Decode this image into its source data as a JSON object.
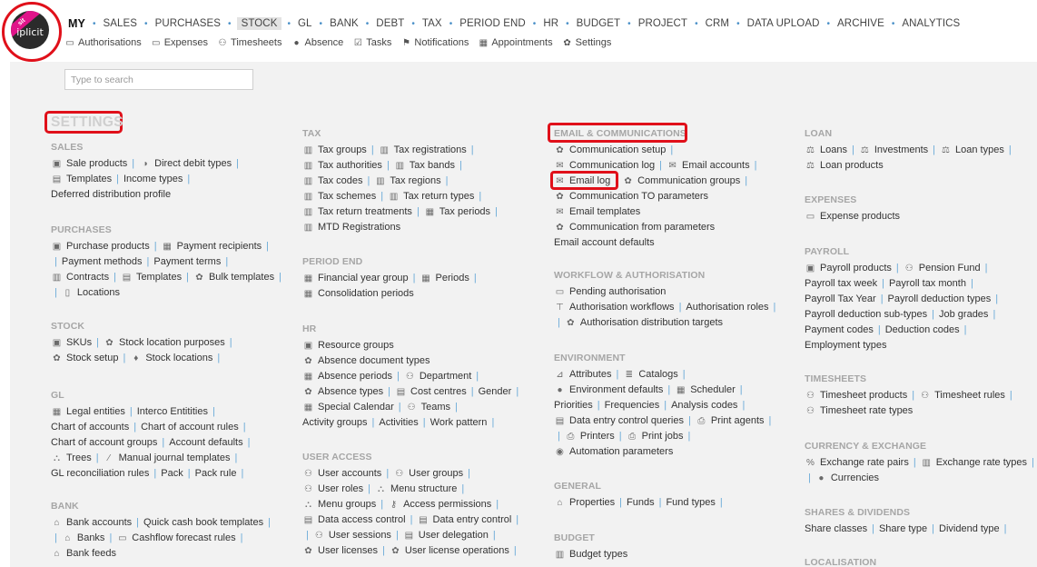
{
  "logo": {
    "ribbon": "sit",
    "text": "iplicit"
  },
  "nav": {
    "main": [
      {
        "label": "MY",
        "kind": "my"
      },
      {
        "label": "SALES"
      },
      {
        "label": "PURCHASES"
      },
      {
        "label": "STOCK",
        "kind": "current"
      },
      {
        "label": "GL"
      },
      {
        "label": "BANK"
      },
      {
        "label": "DEBT"
      },
      {
        "label": "TAX"
      },
      {
        "label": "PERIOD END"
      },
      {
        "label": "HR"
      },
      {
        "label": "BUDGET"
      },
      {
        "label": "PROJECT"
      },
      {
        "label": "CRM"
      },
      {
        "label": "DATA UPLOAD"
      },
      {
        "label": "ARCHIVE"
      },
      {
        "label": "ANALYTICS"
      }
    ],
    "sub": [
      {
        "label": "Authorisations",
        "icon": "chat-icon",
        "glyph": "▭"
      },
      {
        "label": "Expenses",
        "icon": "card-icon",
        "glyph": "▭"
      },
      {
        "label": "Timesheets",
        "icon": "people-icon",
        "glyph": "⚇"
      },
      {
        "label": "Absence",
        "icon": "person-icon",
        "glyph": "●"
      },
      {
        "label": "Tasks",
        "icon": "checkbox-icon",
        "glyph": "☑"
      },
      {
        "label": "Notifications",
        "icon": "flag-icon",
        "glyph": "⚑"
      },
      {
        "label": "Appointments",
        "icon": "calendar-icon",
        "glyph": "▦"
      },
      {
        "label": "Settings",
        "icon": "gear-icon",
        "glyph": "✿"
      }
    ]
  },
  "search": {
    "placeholder": "Type to search"
  },
  "page": {
    "title": "SETTINGS"
  },
  "sections": [
    {
      "key": "sales",
      "title": "SALES",
      "lines": [
        [
          {
            "label": "Sale products",
            "icon": "box-icon",
            "glyph": "▣"
          },
          {
            "label": "Direct debit types",
            "icon": "direct-debit-icon",
            "glyph": "◑"
          }
        ],
        [
          {
            "label": "Templates",
            "icon": "template-icon",
            "glyph": "▤"
          },
          {
            "label": "Income types"
          }
        ],
        [
          {
            "label": "Deferred distribution profile"
          }
        ]
      ]
    },
    {
      "key": "purchases",
      "title": "PURCHASES",
      "lines": [
        [
          {
            "label": "Purchase products",
            "icon": "box-icon",
            "glyph": "▣"
          },
          {
            "label": "Payment recipients",
            "icon": "ledger-icon",
            "glyph": "▦"
          }
        ],
        [
          {
            "label": "Payment methods",
            "lead": true
          },
          {
            "label": "Payment terms"
          }
        ],
        [
          {
            "label": "Contracts",
            "icon": "contract-icon",
            "glyph": "▥"
          },
          {
            "label": "Templates",
            "icon": "template-icon",
            "glyph": "▤"
          },
          {
            "label": "Bulk templates",
            "icon": "gear-icon",
            "glyph": "✿"
          }
        ],
        [
          {
            "label": "Locations",
            "icon": "building-icon",
            "glyph": "▯",
            "lead": true
          }
        ]
      ]
    },
    {
      "key": "stock",
      "title": "STOCK",
      "lines": [
        [
          {
            "label": "SKUs",
            "icon": "box-icon",
            "glyph": "▣"
          },
          {
            "label": "Stock location purposes",
            "icon": "gear-icon",
            "glyph": "✿"
          }
        ],
        [
          {
            "label": "Stock setup",
            "icon": "gear-icon",
            "glyph": "✿"
          },
          {
            "label": "Stock locations",
            "icon": "location-icon",
            "glyph": "♦"
          }
        ]
      ]
    },
    {
      "key": "gl",
      "title": "GL",
      "lines": [
        [
          {
            "label": "Legal entities",
            "icon": "ledger-icon",
            "glyph": "▦"
          },
          {
            "label": "Interco Entitities"
          }
        ],
        [
          {
            "label": "Chart of accounts"
          },
          {
            "label": "Chart of account rules"
          }
        ],
        [
          {
            "label": "Chart of account groups"
          },
          {
            "label": "Account defaults"
          }
        ],
        [
          {
            "label": "Trees",
            "icon": "tree-icon",
            "glyph": "⛬"
          },
          {
            "label": "Manual journal templates",
            "icon": "journal-icon",
            "glyph": "⁄"
          }
        ],
        [
          {
            "label": "GL reconciliation rules"
          },
          {
            "label": "Pack"
          },
          {
            "label": "Pack rule"
          }
        ]
      ]
    },
    {
      "key": "bank",
      "title": "BANK",
      "lines": [
        [
          {
            "label": "Bank accounts",
            "icon": "bank-icon",
            "glyph": "⌂"
          },
          {
            "label": "Quick cash book templates"
          }
        ],
        [
          {
            "label": "Banks",
            "icon": "bank-icon",
            "glyph": "⌂",
            "lead": true
          },
          {
            "label": "Cashflow forecast rules",
            "icon": "forecast-icon",
            "glyph": "▭"
          }
        ],
        [
          {
            "label": "Bank feeds",
            "icon": "bank-feed-icon",
            "glyph": "⌂"
          }
        ]
      ]
    },
    {
      "key": "tax",
      "title": "TAX",
      "lines": [
        [
          {
            "label": "Tax groups",
            "icon": "tax-icon",
            "glyph": "▥"
          },
          {
            "label": "Tax registrations",
            "icon": "tax-icon",
            "glyph": "▥"
          }
        ],
        [
          {
            "label": "Tax authorities",
            "icon": "tax-icon",
            "glyph": "▥"
          },
          {
            "label": "Tax bands",
            "icon": "tax-icon",
            "glyph": "▥"
          }
        ],
        [
          {
            "label": "Tax codes",
            "icon": "tax-icon",
            "glyph": "▥"
          },
          {
            "label": "Tax regions",
            "icon": "tax-icon",
            "glyph": "▥"
          }
        ],
        [
          {
            "label": "Tax schemes",
            "icon": "tax-icon",
            "glyph": "▥"
          },
          {
            "label": "Tax return types",
            "icon": "tax-icon",
            "glyph": "▥"
          }
        ],
        [
          {
            "label": "Tax return treatments",
            "icon": "tax-icon",
            "glyph": "▥"
          },
          {
            "label": "Tax periods",
            "icon": "calendar-icon",
            "glyph": "▦"
          }
        ],
        [
          {
            "label": "MTD Registrations",
            "icon": "tax-icon",
            "glyph": "▥"
          }
        ]
      ]
    },
    {
      "key": "period_end",
      "title": "PERIOD END",
      "lines": [
        [
          {
            "label": "Financial year group",
            "icon": "calendar-icon",
            "glyph": "▦"
          },
          {
            "label": "Periods",
            "icon": "calendar-icon",
            "glyph": "▦"
          }
        ],
        [
          {
            "label": "Consolidation periods",
            "icon": "calendar-icon",
            "glyph": "▦"
          }
        ]
      ]
    },
    {
      "key": "hr",
      "title": "HR",
      "lines": [
        [
          {
            "label": "Resource groups",
            "icon": "box-icon",
            "glyph": "▣"
          }
        ],
        [
          {
            "label": "Absence document types",
            "icon": "gear-icon",
            "glyph": "✿"
          }
        ],
        [
          {
            "label": "Absence periods",
            "icon": "calendar-icon",
            "glyph": "▦"
          },
          {
            "label": "Department",
            "icon": "people-icon",
            "glyph": "⚇"
          }
        ],
        [
          {
            "label": "Absence types",
            "icon": "gear-icon",
            "glyph": "✿"
          },
          {
            "label": "Cost centres",
            "icon": "cost-centre-icon",
            "glyph": "▤"
          },
          {
            "label": "Gender"
          }
        ],
        [
          {
            "label": "Special Calendar",
            "icon": "calendar-icon",
            "glyph": "▦"
          },
          {
            "label": "Teams",
            "icon": "people-icon",
            "glyph": "⚇"
          }
        ],
        [
          {
            "label": "Activity groups"
          },
          {
            "label": "Activities"
          },
          {
            "label": "Work pattern"
          }
        ]
      ]
    },
    {
      "key": "user_access",
      "title": "USER ACCESS",
      "lines": [
        [
          {
            "label": "User accounts",
            "icon": "people-icon",
            "glyph": "⚇"
          },
          {
            "label": "User groups",
            "icon": "people-icon",
            "glyph": "⚇"
          }
        ],
        [
          {
            "label": "User roles",
            "icon": "people-icon",
            "glyph": "⚇"
          },
          {
            "label": "Menu structure",
            "icon": "tree-icon",
            "glyph": "⛬"
          }
        ],
        [
          {
            "label": "Menu groups",
            "icon": "tree-icon",
            "glyph": "⛬"
          },
          {
            "label": "Access permissions",
            "icon": "key-icon",
            "glyph": "⚷"
          }
        ],
        [
          {
            "label": "Data access control",
            "icon": "data-control-icon",
            "glyph": "▤"
          },
          {
            "label": "Data entry control",
            "icon": "data-control-icon",
            "glyph": "▤"
          }
        ],
        [
          {
            "label": "User sessions",
            "icon": "people-icon",
            "glyph": "⚇",
            "lead": true
          },
          {
            "label": "User delegation",
            "icon": "data-control-icon",
            "glyph": "▤"
          }
        ],
        [
          {
            "label": "User licenses",
            "icon": "gear-icon",
            "glyph": "✿"
          },
          {
            "label": "User license operations",
            "icon": "gear-icon",
            "glyph": "✿"
          }
        ]
      ]
    },
    {
      "key": "email",
      "title": "EMAIL & COMMUNICATIONS",
      "lines": [
        [
          {
            "label": "Communication setup",
            "icon": "gear-icon",
            "glyph": "✿",
            "trail": true
          }
        ],
        [
          {
            "label": "Communication log",
            "icon": "envelope-icon",
            "glyph": "✉"
          },
          {
            "label": "Email accounts",
            "icon": "envelope-icon",
            "glyph": "✉"
          }
        ],
        [
          {
            "label": "Email log",
            "icon": "envelope-icon",
            "glyph": "✉"
          },
          {
            "label": "Communication groups",
            "icon": "gear-icon",
            "glyph": "✿"
          }
        ],
        [
          {
            "label": "Communication TO parameters",
            "icon": "gear-icon",
            "glyph": "✿"
          }
        ],
        [
          {
            "label": "Email templates",
            "icon": "envelope-icon",
            "glyph": "✉"
          }
        ],
        [
          {
            "label": "Communication from parameters",
            "icon": "gear-icon",
            "glyph": "✿"
          }
        ],
        [
          {
            "label": "Email account defaults"
          }
        ]
      ]
    },
    {
      "key": "workflow",
      "title": "WORKFLOW & AUTHORISATION",
      "lines": [
        [
          {
            "label": "Pending authorisation",
            "icon": "chat-icon",
            "glyph": "▭"
          }
        ],
        [
          {
            "label": "Authorisation workflows",
            "icon": "workflow-icon",
            "glyph": "⊤"
          },
          {
            "label": "Authorisation roles"
          }
        ],
        [
          {
            "label": "Authorisation distribution targets",
            "icon": "gear-icon",
            "glyph": "✿",
            "lead": true
          }
        ]
      ]
    },
    {
      "key": "environment",
      "title": "ENVIRONMENT",
      "lines": [
        [
          {
            "label": "Attributes",
            "icon": "attribute-icon",
            "glyph": "⊿"
          },
          {
            "label": "Catalogs",
            "icon": "catalog-icon",
            "glyph": "≣"
          }
        ],
        [
          {
            "label": "Environment defaults",
            "icon": "person-icon",
            "glyph": "●"
          },
          {
            "label": "Scheduler",
            "icon": "calendar-icon",
            "glyph": "▦"
          }
        ],
        [
          {
            "label": "Priorities"
          },
          {
            "label": "Frequencies"
          },
          {
            "label": "Analysis codes"
          }
        ],
        [
          {
            "label": "Data entry control queries",
            "icon": "data-control-icon",
            "glyph": "▤"
          },
          {
            "label": "Print agents",
            "icon": "printer-icon",
            "glyph": "⎙"
          }
        ],
        [
          {
            "label": "Printers",
            "icon": "printer-icon",
            "glyph": "⎙",
            "lead": true
          },
          {
            "label": "Print jobs",
            "icon": "printer-icon",
            "glyph": "⎙"
          }
        ],
        [
          {
            "label": "Automation parameters",
            "icon": "automation-icon",
            "glyph": "◉"
          }
        ]
      ]
    },
    {
      "key": "general",
      "title": "GENERAL",
      "lines": [
        [
          {
            "label": "Properties",
            "icon": "home-icon",
            "glyph": "⌂"
          },
          {
            "label": "Funds"
          },
          {
            "label": "Fund types"
          }
        ]
      ]
    },
    {
      "key": "budget",
      "title": "BUDGET",
      "lines": [
        [
          {
            "label": "Budget types",
            "icon": "tax-icon",
            "glyph": "▥"
          }
        ]
      ]
    },
    {
      "key": "loan",
      "title": "LOAN",
      "lines": [
        [
          {
            "label": "Loans",
            "icon": "loan-icon",
            "glyph": "⚖"
          },
          {
            "label": "Investments",
            "icon": "investment-icon",
            "glyph": "⚖"
          },
          {
            "label": "Loan types",
            "icon": "loan-icon",
            "glyph": "⚖"
          }
        ],
        [
          {
            "label": "Loan products",
            "icon": "loan-icon",
            "glyph": "⚖"
          }
        ]
      ]
    },
    {
      "key": "expenses",
      "title": "EXPENSES",
      "lines": [
        [
          {
            "label": "Expense products",
            "icon": "card-icon",
            "glyph": "▭"
          }
        ]
      ]
    },
    {
      "key": "payroll",
      "title": "PAYROLL",
      "lines": [
        [
          {
            "label": "Payroll products",
            "icon": "box-icon",
            "glyph": "▣"
          },
          {
            "label": "Pension Fund",
            "icon": "people-icon",
            "glyph": "⚇"
          }
        ],
        [
          {
            "label": "Payroll tax week"
          },
          {
            "label": "Payroll tax month"
          }
        ],
        [
          {
            "label": "Payroll Tax Year"
          },
          {
            "label": "Payroll deduction types"
          }
        ],
        [
          {
            "label": "Payroll deduction sub-types"
          },
          {
            "label": "Job grades"
          }
        ],
        [
          {
            "label": "Payment codes"
          },
          {
            "label": "Deduction codes"
          }
        ],
        [
          {
            "label": "Employment types"
          }
        ]
      ]
    },
    {
      "key": "timesheets",
      "title": "TIMESHEETS",
      "lines": [
        [
          {
            "label": "Timesheet products",
            "icon": "people-icon",
            "glyph": "⚇"
          },
          {
            "label": "Timesheet rules",
            "icon": "people-icon",
            "glyph": "⚇"
          }
        ],
        [
          {
            "label": "Timesheet rate types",
            "icon": "people-icon",
            "glyph": "⚇"
          }
        ]
      ]
    },
    {
      "key": "currency",
      "title": "CURRENCY & EXCHANGE",
      "lines": [
        [
          {
            "label": "Exchange rate pairs",
            "icon": "percent-icon",
            "glyph": "%"
          },
          {
            "label": "Exchange rate types",
            "icon": "tax-icon",
            "glyph": "▥"
          }
        ],
        [
          {
            "label": "Currencies",
            "icon": "currency-icon",
            "glyph": "●",
            "lead": true
          }
        ]
      ]
    },
    {
      "key": "shares",
      "title": "SHARES & DIVIDENDS",
      "lines": [
        [
          {
            "label": "Share classes"
          },
          {
            "label": "Share type"
          },
          {
            "label": "Dividend type"
          }
        ]
      ]
    },
    {
      "key": "localisation",
      "title": "LOCALISATION",
      "lines": []
    }
  ]
}
